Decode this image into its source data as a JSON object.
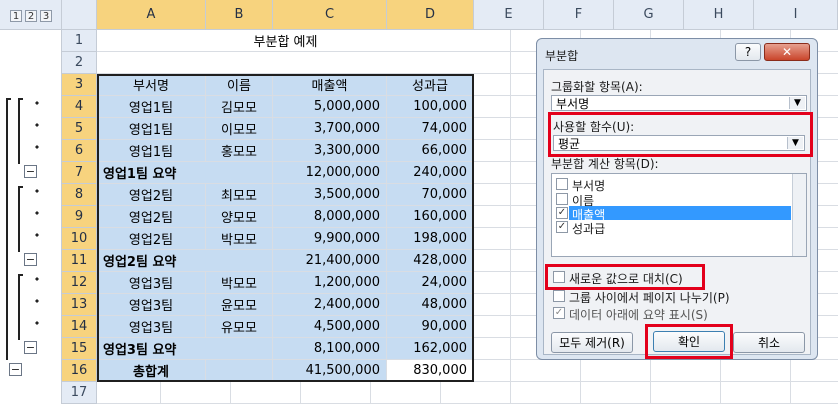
{
  "outline": {
    "levels": [
      "1",
      "2",
      "3"
    ],
    "group_controls": [
      "−",
      "−",
      "−",
      "−"
    ]
  },
  "columns": [
    "A",
    "B",
    "C",
    "D",
    "E",
    "F",
    "G",
    "H",
    "I"
  ],
  "rows": [
    "1",
    "2",
    "3",
    "4",
    "5",
    "6",
    "7",
    "8",
    "9",
    "10",
    "11",
    "12",
    "13",
    "14",
    "15",
    "16",
    "17"
  ],
  "sheet": {
    "title": "부분합 예제",
    "headers": [
      "부서명",
      "이름",
      "매출액",
      "성과급"
    ],
    "data": [
      [
        "영업1팀",
        "김모모",
        "5,000,000",
        "100,000"
      ],
      [
        "영업1팀",
        "이모모",
        "3,700,000",
        "74,000"
      ],
      [
        "영업1팀",
        "홍모모",
        "3,300,000",
        "66,000"
      ],
      [
        "영업1팀 요약",
        "",
        "12,000,000",
        "240,000"
      ],
      [
        "영업2팀",
        "최모모",
        "3,500,000",
        "70,000"
      ],
      [
        "영업2팀",
        "양모모",
        "8,000,000",
        "160,000"
      ],
      [
        "영업2팀",
        "박모모",
        "9,900,000",
        "198,000"
      ],
      [
        "영업2팀 요약",
        "",
        "21,400,000",
        "428,000"
      ],
      [
        "영업3팀",
        "박모모",
        "1,200,000",
        "24,000"
      ],
      [
        "영업3팀",
        "윤모모",
        "2,400,000",
        "48,000"
      ],
      [
        "영업3팀",
        "유모모",
        "4,500,000",
        "90,000"
      ],
      [
        "영업3팀 요약",
        "",
        "8,100,000",
        "162,000"
      ],
      [
        "총합계",
        "",
        "41,500,000",
        "830,000"
      ]
    ]
  },
  "dialog": {
    "title": "부분합",
    "help": "?",
    "close": "✕",
    "group_label": "그룹화할 항목(A):",
    "group_value": "부서명",
    "func_label": "사용할 함수(U):",
    "func_value": "평균",
    "calc_label": "부분합 계산 항목(D):",
    "calc_items": [
      {
        "label": "부서명",
        "checked": false
      },
      {
        "label": "이름",
        "checked": false
      },
      {
        "label": "매출액",
        "checked": true
      },
      {
        "label": "성과급",
        "checked": true
      }
    ],
    "opt1": "새로운 값으로 대치(C)",
    "opt2": "그룹 사이에서 페이지 나누기(P)",
    "opt3": "데이터 아래에 요약 표시(S)",
    "remove_btn": "모두 제거(R)",
    "ok_btn": "확인",
    "cancel_btn": "취소",
    "check_mark": "✓",
    "dropdown_arrow": "▼"
  },
  "colors": {
    "highlight_red": "#e3001b",
    "cell_blue": "#c6dcf2",
    "selected_header": "#f7d37e"
  }
}
